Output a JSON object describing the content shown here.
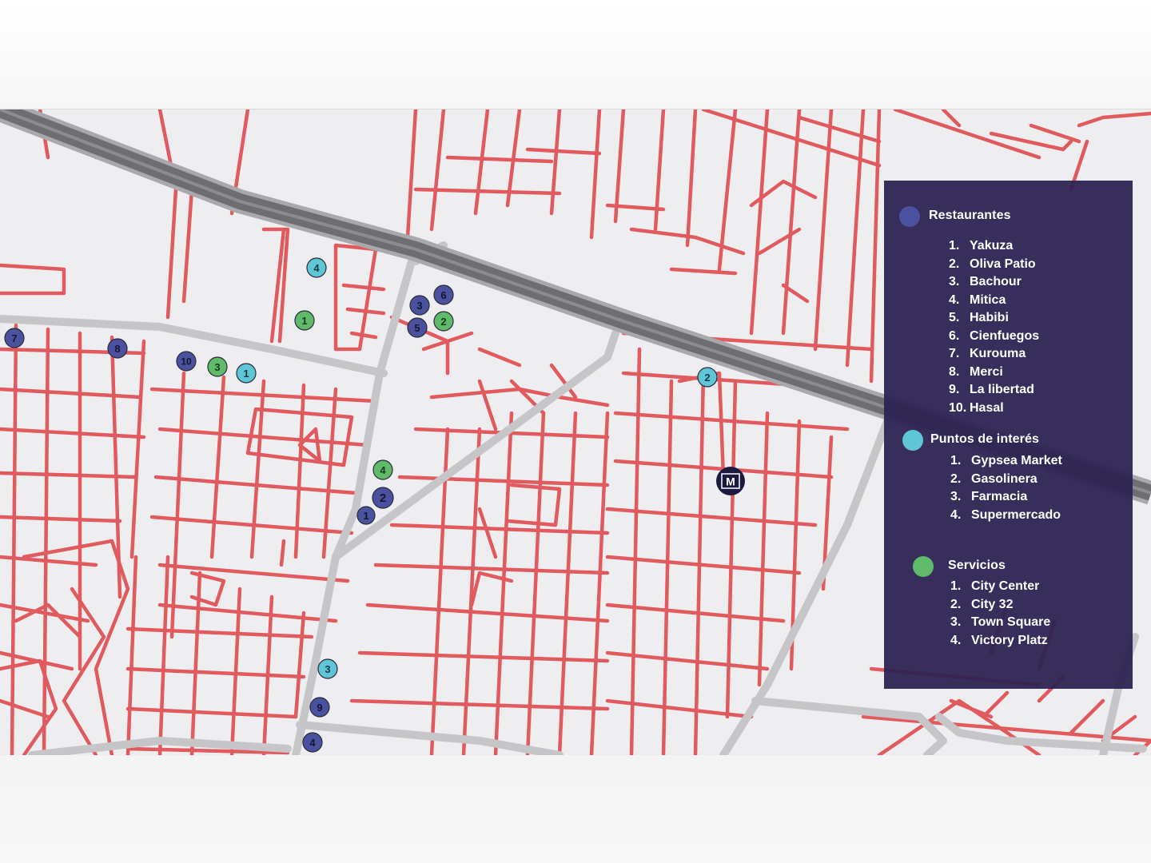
{
  "colors": {
    "map_background": "#eeeef0",
    "street_red": "#e15a5e",
    "avenue_gray": "#c6c6c9",
    "highway_dark": "#6e6e72",
    "legend_background": "#2d2352",
    "restaurant_marker": "#4a52a0",
    "interest_marker": "#5ec6d6",
    "services_marker": "#5fbb6a",
    "brand_marker": "#1c1940"
  },
  "brand_marker": {
    "icon": "property-logo-icon",
    "label": "M"
  },
  "legend": {
    "restaurants": {
      "title": "Restaurantes",
      "items": [
        {
          "num": "1.",
          "name": "Yakuza"
        },
        {
          "num": "2.",
          "name": "Oliva Patio"
        },
        {
          "num": "3.",
          "name": "Bachour"
        },
        {
          "num": "4.",
          "name": "Mitica"
        },
        {
          "num": "5.",
          "name": "Habibi"
        },
        {
          "num": "6.",
          "name": "Cienfuegos"
        },
        {
          "num": "7.",
          "name": "Kurouma"
        },
        {
          "num": "8.",
          "name": "Merci"
        },
        {
          "num": "9.",
          "name": "La libertad"
        },
        {
          "num": "10.",
          "name": "Hasal"
        }
      ]
    },
    "interest": {
      "title": "Puntos de interés",
      "items": [
        {
          "num": "1.",
          "name": "Gypsea Market"
        },
        {
          "num": "2.",
          "name": "Gasolinera"
        },
        {
          "num": "3.",
          "name": "Farmacia"
        },
        {
          "num": "4.",
          "name": "Supermercado"
        }
      ]
    },
    "services": {
      "title": "Servicios",
      "items": [
        {
          "num": "1.",
          "name": "City Center"
        },
        {
          "num": "2.",
          "name": "City 32"
        },
        {
          "num": "3.",
          "name": "Town Square"
        },
        {
          "num": "4.",
          "name": "Victory Platz"
        }
      ]
    }
  },
  "markers": {
    "restaurants": [
      "1",
      "2",
      "3",
      "4",
      "5",
      "6",
      "7",
      "8",
      "9",
      "10"
    ],
    "interest": [
      "1",
      "2",
      "3",
      "4"
    ],
    "services": [
      "1",
      "2",
      "3",
      "4"
    ]
  }
}
